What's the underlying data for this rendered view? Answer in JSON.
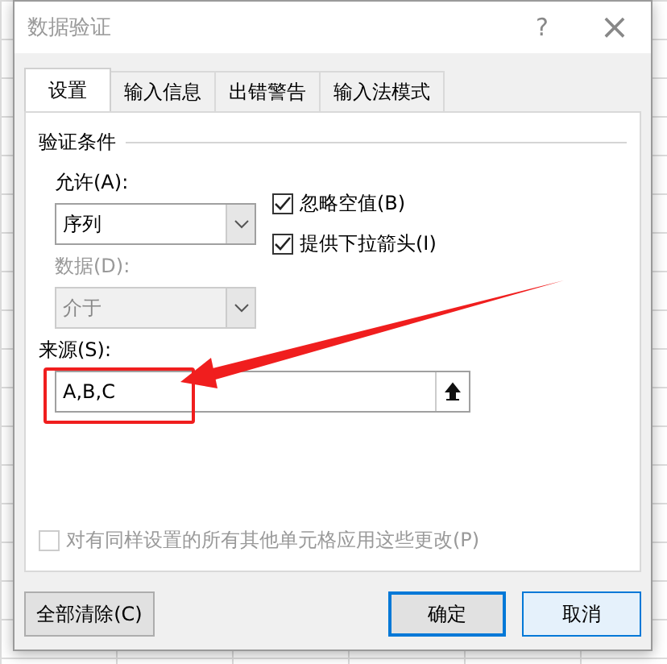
{
  "window": {
    "title": "数据验证",
    "help": "?",
    "close": "×"
  },
  "tabs": [
    {
      "label": "设置",
      "selected": true
    },
    {
      "label": "输入信息",
      "selected": false
    },
    {
      "label": "出错警告",
      "selected": false
    },
    {
      "label": "输入法模式",
      "selected": false
    }
  ],
  "group_title": "验证条件",
  "allow": {
    "label": "允许(A):",
    "value": "序列",
    "disabled": false
  },
  "data": {
    "label": "数据(D):",
    "value": "介于",
    "disabled": true
  },
  "options": [
    {
      "label": "忽略空值(B)",
      "checked": true,
      "disabled": false
    },
    {
      "label": "提供下拉箭头(I)",
      "checked": true,
      "disabled": false
    }
  ],
  "source": {
    "label": "来源(S):",
    "value": "A,B,C"
  },
  "apply_all": {
    "label": "对有同样设置的所有其他单元格应用这些更改(P)",
    "checked": false,
    "disabled": true
  },
  "buttons": [
    {
      "label": "全部清除(C)",
      "kind": "plain"
    },
    {
      "label": "确定",
      "kind": "default"
    },
    {
      "label": "取消",
      "kind": "hover"
    }
  ]
}
